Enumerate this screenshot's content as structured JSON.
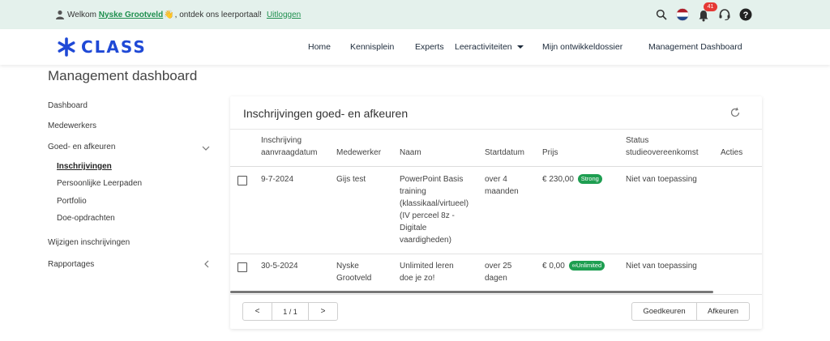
{
  "topbar": {
    "welcome_prefix": "Welkom",
    "user_name": "Nyske Grootveld",
    "wave": "👋",
    "welcome_suffix": ", ontdek ons leerportaal!",
    "logout_label": "Uitloggen",
    "notification_count": "41",
    "icons": [
      "search-icon",
      "dutch-flag-icon",
      "bell-icon",
      "support-icon",
      "help-icon"
    ]
  },
  "nav": {
    "logo_text": "CLASS",
    "links": [
      "Home",
      "Kennisplein",
      "Experts",
      "Leeractiviteiten",
      "Mijn ontwikkeldossier",
      "Management Dashboard"
    ]
  },
  "page": {
    "title": "Management dashboard"
  },
  "sidebar": {
    "items": [
      {
        "label": "Dashboard"
      },
      {
        "label": "Medewerkers"
      },
      {
        "label": "Goed- en afkeuren"
      },
      {
        "label": "Wijzigen inschrijvingen"
      },
      {
        "label": "Rapportages"
      }
    ],
    "sub_items": [
      {
        "label": "Inschrijvingen"
      },
      {
        "label": "Persoonlijke Leerpaden"
      },
      {
        "label": "Portfolio"
      },
      {
        "label": "Doe-opdrachten"
      }
    ]
  },
  "card": {
    "title": "Inschrijvingen goed- en afkeuren",
    "columns": {
      "date": [
        "Inschrijving",
        "aanvraagdatum"
      ],
      "employee": "Medewerker",
      "name": "Naam",
      "start": "Startdatum",
      "price": "Prijs",
      "status": [
        "Status",
        "studieovereenkomst"
      ],
      "actions": "Acties"
    },
    "rows": [
      {
        "date": "9-7-2024",
        "employee": "Gijs test",
        "name": [
          "PowerPoint Basis",
          "training",
          "(klassikaal/virtueel)",
          "(IV perceel 8z -",
          "Digitale",
          "vaardigheden)"
        ],
        "start": [
          "over 4",
          "maanden"
        ],
        "price": "€ 230,00",
        "badge": "Strong",
        "status": "Niet van toepassing"
      },
      {
        "date": "30-5-2024",
        "employee": [
          "Nyske",
          "Grootveld"
        ],
        "name": [
          "Unlimited leren",
          "doe je zo!"
        ],
        "start": [
          "over 25",
          "dagen"
        ],
        "price": "€ 0,00",
        "badge": "Unlimited",
        "status": "Niet van toepassing"
      }
    ],
    "pagination": {
      "prev": "<",
      "info": "1 / 1",
      "next": ">"
    },
    "approve_label": "Goedkeuren",
    "reject_label": "Afkeuren"
  },
  "colors": {
    "brand_blue": "#1f49d6",
    "accent_green": "#1e9e51",
    "topbar_bg": "#e4f1ec",
    "badge_red": "#e53935"
  }
}
